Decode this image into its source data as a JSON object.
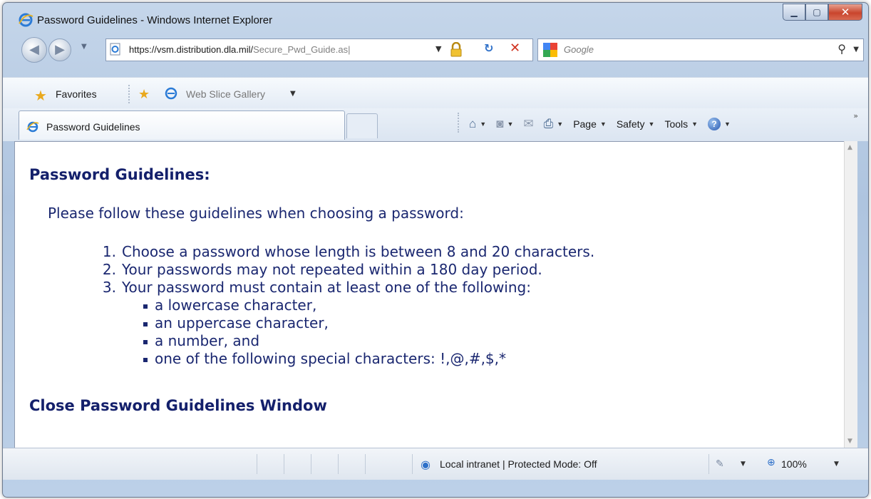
{
  "window": {
    "title": "Password Guidelines - Windows Internet Explorer"
  },
  "address": {
    "url_visible": "https://vsm.distribution.dla.mil/",
    "url_faded": "Secure_Pwd_Guide.as|"
  },
  "search": {
    "placeholder": "Google"
  },
  "favorites": {
    "label": "Favorites",
    "web_slice_label": "Web Slice Gallery"
  },
  "tab": {
    "label": "Password Guidelines"
  },
  "commandbar": {
    "page": "Page",
    "safety": "Safety",
    "tools": "Tools"
  },
  "content": {
    "heading": "Password Guidelines:",
    "intro": "Please follow these guidelines when choosing a password:",
    "rules": [
      {
        "num": "1.",
        "text": "Choose a password whose length is between 8 and 20 characters."
      },
      {
        "num": "2.",
        "text": "Your passwords may not repeated within a 180 day period."
      },
      {
        "num": "3.",
        "text": "Your password must contain at least one of the following:"
      }
    ],
    "subrules": [
      "a lowercase character,",
      "an uppercase character,",
      "a number, and",
      "one of the following special characters: !,@,#,$,*"
    ],
    "close_link": "Close Password Guidelines Window"
  },
  "statusbar": {
    "zone": "Local intranet | Protected Mode: Off",
    "zoom": "100%"
  },
  "colors": {
    "content_text": "#1a2770",
    "heading": "#14206b",
    "close_button": "#c9452d"
  },
  "icons": [
    "ie-logo-icon",
    "back-icon",
    "forward-icon",
    "page-icon",
    "lock-icon",
    "refresh-icon",
    "stop-icon",
    "google-icon",
    "search-icon",
    "favorites-star-icon",
    "add-favorites-icon",
    "home-icon",
    "feeds-icon",
    "mail-icon",
    "print-icon",
    "help-icon",
    "globe-zone-icon",
    "zoom-icon"
  ]
}
